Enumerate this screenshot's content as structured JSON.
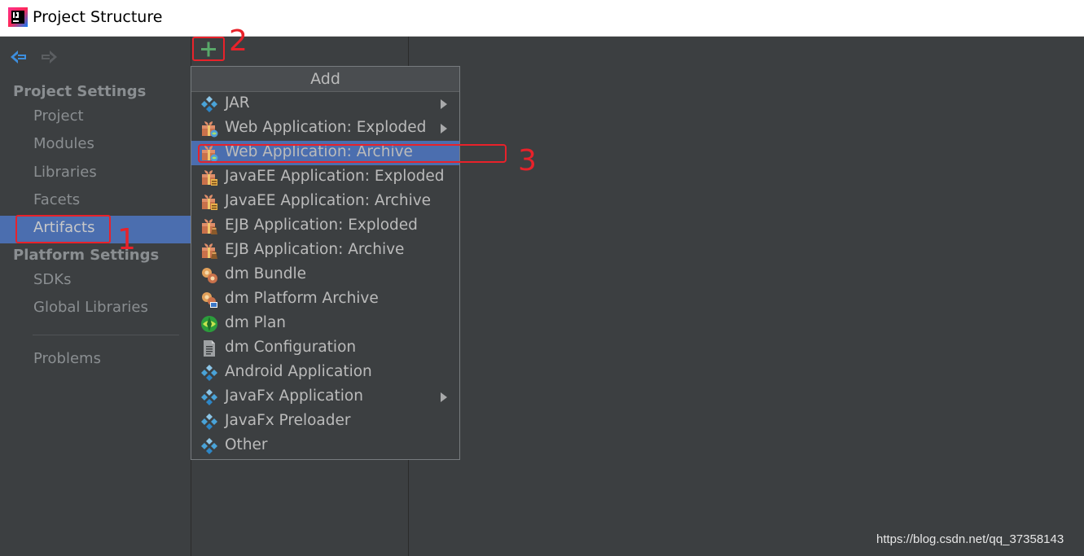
{
  "window": {
    "title": "Project Structure"
  },
  "sidebar": {
    "sections": [
      {
        "title": "Project Settings",
        "items": [
          "Project",
          "Modules",
          "Libraries",
          "Facets",
          "Artifacts"
        ]
      },
      {
        "title": "Platform Settings",
        "items": [
          "SDKs",
          "Global Libraries"
        ]
      }
    ],
    "problems": "Problems",
    "selected": "Artifacts"
  },
  "popup": {
    "title": "Add",
    "items": [
      {
        "label": "JAR",
        "icon": "diamond-icon",
        "submenu": true
      },
      {
        "label": "Web Application: Exploded",
        "icon": "gift-web-icon",
        "submenu": true
      },
      {
        "label": "Web Application: Archive",
        "icon": "gift-web-icon",
        "submenu": false,
        "highlighted": true
      },
      {
        "label": "JavaEE Application: Exploded",
        "icon": "gift-ee-icon",
        "submenu": false
      },
      {
        "label": "JavaEE Application: Archive",
        "icon": "gift-ee-icon",
        "submenu": false
      },
      {
        "label": "EJB Application: Exploded",
        "icon": "gift-ejb-icon",
        "submenu": false
      },
      {
        "label": "EJB Application: Archive",
        "icon": "gift-ejb-icon",
        "submenu": false
      },
      {
        "label": "dm Bundle",
        "icon": "bundle-icon",
        "submenu": false
      },
      {
        "label": "dm Platform Archive",
        "icon": "bundle-archive-icon",
        "submenu": false
      },
      {
        "label": "dm Plan",
        "icon": "plan-icon",
        "submenu": false
      },
      {
        "label": "dm Configuration",
        "icon": "document-icon",
        "submenu": false
      },
      {
        "label": "Android Application",
        "icon": "diamond-icon",
        "submenu": false
      },
      {
        "label": "JavaFx Application",
        "icon": "diamond-icon",
        "submenu": true
      },
      {
        "label": "JavaFx Preloader",
        "icon": "diamond-icon",
        "submenu": false
      },
      {
        "label": "Other",
        "icon": "diamond-icon",
        "submenu": false
      }
    ]
  },
  "annotations": [
    "1",
    "2",
    "3"
  ],
  "watermark": "https://blog.csdn.net/qq_37358143",
  "colors": {
    "background": "#3c3f41",
    "selection": "#4b6eaf",
    "annotation": "#e8222a",
    "add_green": "#59a869"
  }
}
